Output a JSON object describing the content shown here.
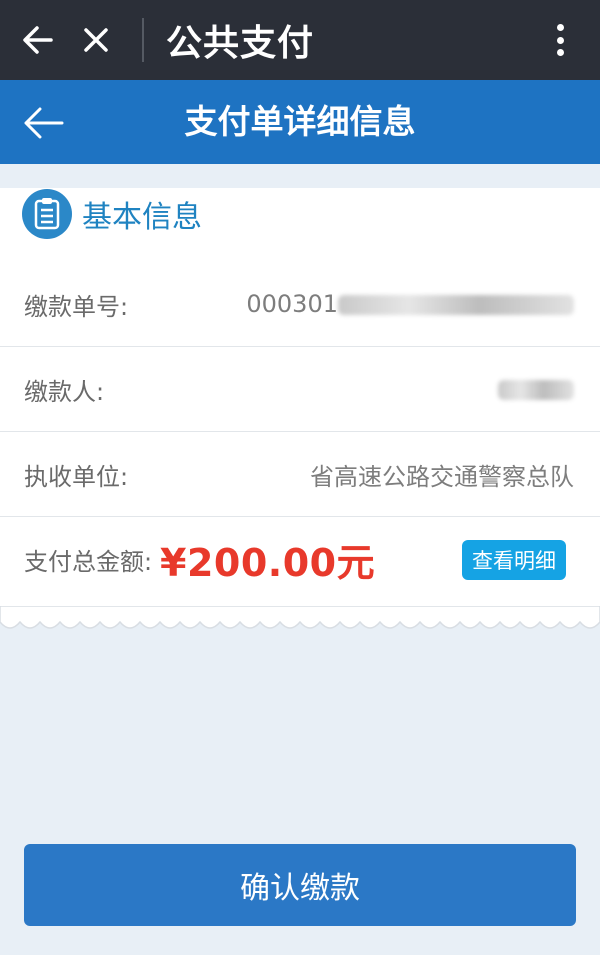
{
  "app": {
    "title": "公共支付"
  },
  "header": {
    "title": "支付单详细信息"
  },
  "section": {
    "title": "基本信息"
  },
  "rows": {
    "order_no": {
      "label": "缴款单号:",
      "value_prefix": "000301"
    },
    "payer": {
      "label": "缴款人:"
    },
    "collector": {
      "label": "执收单位:",
      "value": "省高速公路交通警察总队"
    },
    "total": {
      "label": "支付总金额:",
      "amount": "¥200.00元",
      "detail_label": "查看明细"
    }
  },
  "actions": {
    "confirm_label": "确认缴款"
  },
  "colors": {
    "top_bar": "#2b2f38",
    "header": "#1e73c2",
    "accent": "#1f83c1",
    "amount": "#e8392b",
    "detail_button": "#15a3e4",
    "confirm_button": "#2b78c6",
    "background": "#e8eff6"
  },
  "icons": {
    "back": "arrow-left-icon",
    "close": "close-icon",
    "more": "more-vertical-icon",
    "section": "document-list-icon"
  }
}
